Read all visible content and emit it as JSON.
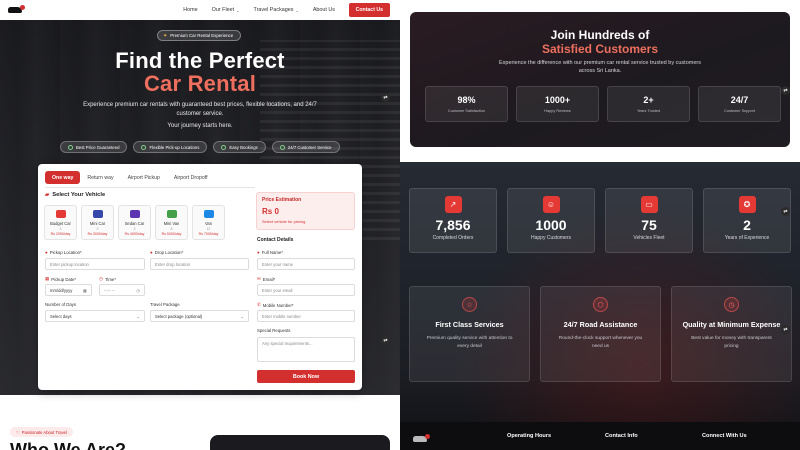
{
  "nav": {
    "links": [
      {
        "label": "Home",
        "dropdown": false
      },
      {
        "label": "Our Fleet",
        "dropdown": true
      },
      {
        "label": "Travel Packages",
        "dropdown": true
      },
      {
        "label": "About Us",
        "dropdown": false
      }
    ],
    "contact_label": "Contact Us"
  },
  "hero": {
    "badge": "Premium Car Rental Experience",
    "title_line1": "Find the Perfect",
    "title_line2": "Car Rental",
    "subtitle": "Experience premium car rentals with guaranteed best prices, flexible locations, and 24/7 customer service.",
    "subtitle2": "Your journey starts here.",
    "pills": [
      "Best Price Guaranteed",
      "Flexible Pick-up Locations",
      "Easy Bookings",
      "24/7 Customer Service"
    ]
  },
  "booking": {
    "tabs": [
      {
        "label": "One way",
        "active": true
      },
      {
        "label": "Return way",
        "active": false
      },
      {
        "label": "Airport Pickup",
        "active": false
      },
      {
        "label": "Airport Dropoff",
        "active": false
      }
    ],
    "select_vehicle_title": "Select Your Vehicle",
    "vehicles": [
      {
        "name": "Budget Car",
        "seats": "3",
        "price": "Rs 2000/day",
        "color": "#e53935"
      },
      {
        "name": "Mini Car",
        "seats": "3",
        "price": "Rs 3000/day",
        "color": "#3949ab"
      },
      {
        "name": "Sedan Car",
        "seats": "3",
        "price": "Rs 4000/day",
        "color": "#5e35b1"
      },
      {
        "name": "Mini Van",
        "seats": "8",
        "price": "Rs 5000/day",
        "color": "#43a047"
      },
      {
        "name": "Van",
        "seats": "12",
        "price": "Rs 7000/day",
        "color": "#1e88e5"
      }
    ],
    "price": {
      "title": "Price Estimation",
      "value": "Rs 0",
      "note": "Select vehicle for pricing"
    },
    "pickup_location": {
      "label": "Pickup Location*",
      "placeholder": "Enter pickup location"
    },
    "drop_location": {
      "label": "Drop Location*",
      "placeholder": "Enter drop location"
    },
    "pickup_date": {
      "label": "Pickup Date*",
      "value": "mm/dd/yyyy"
    },
    "time": {
      "label": "Time*",
      "value": "--:-- --"
    },
    "days": {
      "label": "Number of Days",
      "value": "Select days"
    },
    "package": {
      "label": "Travel Package",
      "value": "Select package (optional)"
    },
    "contact_title": "Contact Details",
    "full_name": {
      "label": "Full Name*",
      "placeholder": "Enter your name"
    },
    "email": {
      "label": "Email*",
      "placeholder": "Enter your email"
    },
    "mobile": {
      "label": "Mobile Number*",
      "placeholder": "Enter mobile number"
    },
    "requests": {
      "label": "Special Requests",
      "placeholder": "Any special requirements..."
    },
    "book_label": "Book Now"
  },
  "about": {
    "badge": "Passionate About Travel",
    "title": "Who We Are?"
  },
  "join": {
    "title1": "Join Hundreds of",
    "title2": "Satisfied Customers",
    "subtitle": "Experience the difference with our premium car rental service trusted by customers across Sri Lanka.",
    "stats": [
      {
        "value": "98%",
        "label": "Customer Satisfaction"
      },
      {
        "value": "1000+",
        "label": "Happy Reviews"
      },
      {
        "value": "2+",
        "label": "Years Trusted"
      },
      {
        "value": "24/7",
        "label": "Customer Support"
      }
    ]
  },
  "counters": [
    {
      "icon": "trend-icon",
      "glyph": "↗",
      "value": "7,856",
      "label": "Completed Orders"
    },
    {
      "icon": "users-icon",
      "glyph": "☺",
      "value": "1000",
      "label": "Happy Customers"
    },
    {
      "icon": "truck-icon",
      "glyph": "▭",
      "value": "75",
      "label": "Vehicles Fleet"
    },
    {
      "icon": "award-icon",
      "glyph": "✪",
      "value": "2",
      "label": "Years of Experience"
    }
  ],
  "features": [
    {
      "icon": "star-icon",
      "glyph": "☆",
      "title": "First Class Services",
      "desc": "Premium quality service with attention to every detail"
    },
    {
      "icon": "shield-icon",
      "glyph": "⬡",
      "title": "24/7 Road Assistance",
      "desc": "Round-the-clock support whenever you need us"
    },
    {
      "icon": "clock-icon",
      "glyph": "◷",
      "title": "Quality at Minimum Expense",
      "desc": "Best value for money with transparent pricing"
    }
  ],
  "footer": {
    "headings": [
      "Operating Hours",
      "Contact Info",
      "Connect With Us"
    ]
  }
}
